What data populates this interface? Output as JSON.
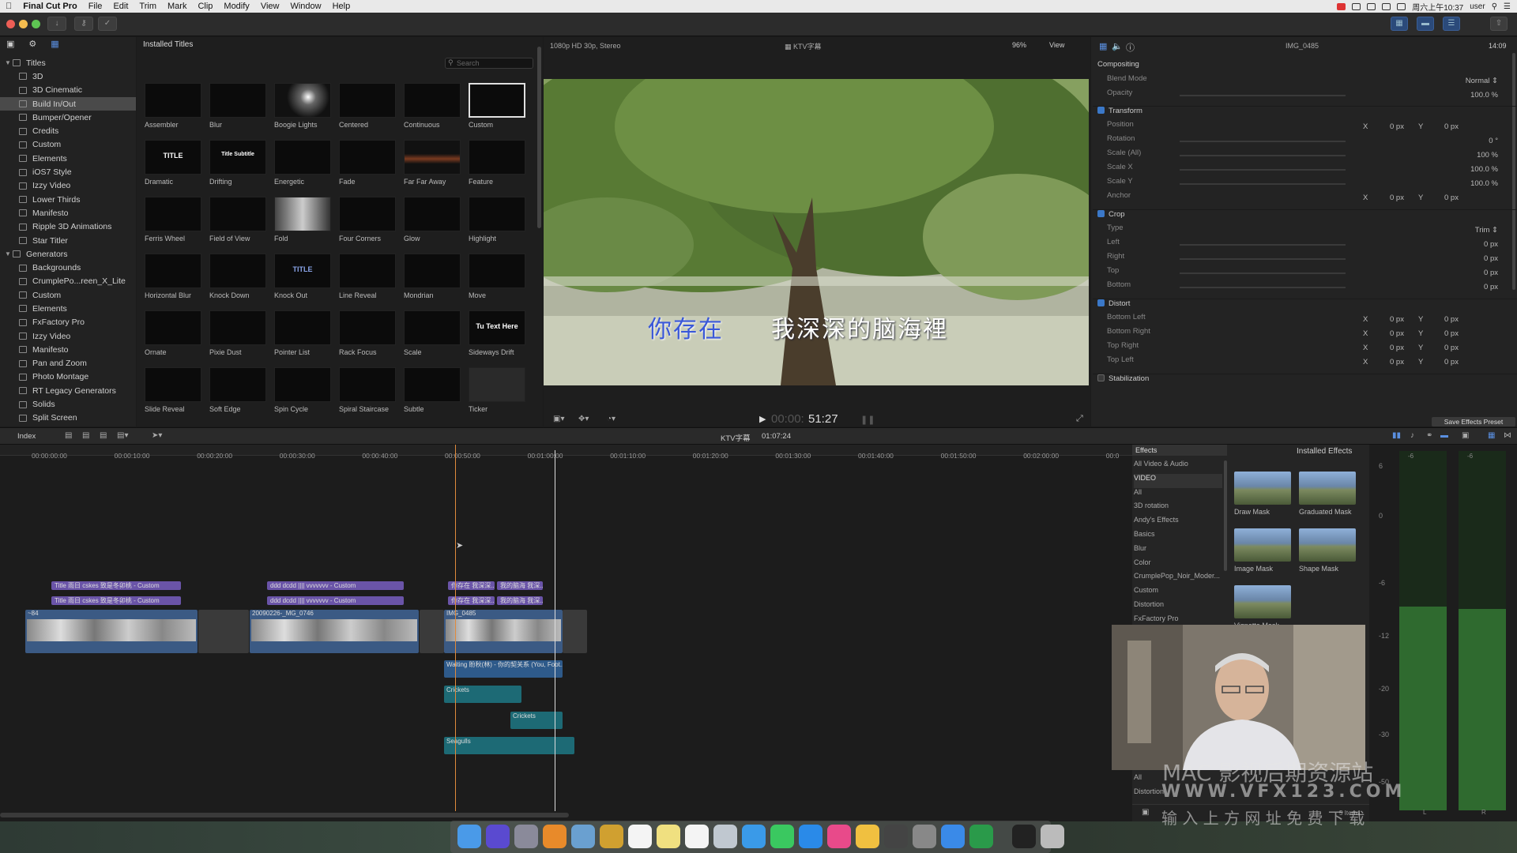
{
  "menubar": {
    "app": "Final Cut Pro",
    "items": [
      "File",
      "Edit",
      "Trim",
      "Mark",
      "Clip",
      "Modify",
      "View",
      "Window",
      "Help"
    ],
    "clock": "周六上午10:37",
    "user": "user"
  },
  "browser": {
    "title": "Installed Titles",
    "search_placeholder": "Search",
    "categories": [
      {
        "label": "Titles",
        "group": true
      },
      {
        "label": "3D"
      },
      {
        "label": "3D Cinematic"
      },
      {
        "label": "Build In/Out",
        "selected": true
      },
      {
        "label": "Bumper/Opener"
      },
      {
        "label": "Credits"
      },
      {
        "label": "Custom"
      },
      {
        "label": "Elements"
      },
      {
        "label": "iOS7 Style"
      },
      {
        "label": "Izzy Video"
      },
      {
        "label": "Lower Thirds"
      },
      {
        "label": "Manifesto"
      },
      {
        "label": "Ripple 3D Animations"
      },
      {
        "label": "Star Titler"
      },
      {
        "label": "Generators",
        "group": true
      },
      {
        "label": "Backgrounds"
      },
      {
        "label": "CrumplePo...reen_X_Lite"
      },
      {
        "label": "Custom"
      },
      {
        "label": "Elements"
      },
      {
        "label": "FxFactory Pro"
      },
      {
        "label": "Izzy Video"
      },
      {
        "label": "Manifesto"
      },
      {
        "label": "Pan and Zoom"
      },
      {
        "label": "Photo Montage"
      },
      {
        "label": "RT Legacy Generators"
      },
      {
        "label": "Solids"
      },
      {
        "label": "Split Screen"
      }
    ],
    "thumbnails": [
      "Assembler",
      "Blur",
      "Boogie Lights",
      "Centered",
      "Continuous",
      "Custom",
      "Dramatic",
      "Drifting",
      "Energetic",
      "Fade",
      "Far Far Away",
      "Feature",
      "Ferris Wheel",
      "Field of View",
      "Fold",
      "Four Corners",
      "Glow",
      "Highlight",
      "Horizontal Blur",
      "Knock Down",
      "Knock Out",
      "Line Reveal",
      "Mondrian",
      "Move",
      "Ornate",
      "Pixie Dust",
      "Pointer List",
      "Rack Focus",
      "Scale",
      "Sideways Drift",
      "Slide Reveal",
      "Soft Edge",
      "Spin Cycle",
      "Spiral Staircase",
      "Subtle",
      "Ticker"
    ],
    "thumb_texts": {
      "dramatic": "TITLE",
      "drifting": "Title Subtitle",
      "knockout": "TITLE",
      "sideways": "Tu Text Here"
    }
  },
  "viewer": {
    "format": "1080p HD 30p, Stereo",
    "project": "KTV字幕",
    "zoom": "96%",
    "view_label": "View",
    "subtitle_blue": "你存在",
    "subtitle_white": "我深深的脑海裡",
    "timecode_dim": "00:00:",
    "timecode": "51:27"
  },
  "inspector": {
    "clip_name": "IMG_0485",
    "duration": "14:09",
    "rows": [
      {
        "label": "Compositing",
        "section": true
      },
      {
        "label": "Blend Mode",
        "value": "Normal ⇕"
      },
      {
        "label": "Opacity",
        "value": "100.0  %"
      },
      {
        "label": "Transform",
        "section": true,
        "check": true
      },
      {
        "label": "Position",
        "x": "0  px",
        "y": "0  px"
      },
      {
        "label": "Rotation",
        "value": "0  °"
      },
      {
        "label": "Scale (All)",
        "value": "100  %"
      },
      {
        "label": "Scale X",
        "value": "100.0  %"
      },
      {
        "label": "Scale Y",
        "value": "100.0  %"
      },
      {
        "label": "Anchor",
        "x": "0  px",
        "y": "0  px"
      },
      {
        "label": "Crop",
        "section": true,
        "check": true
      },
      {
        "label": "Type",
        "value": "Trim ⇕"
      },
      {
        "label": "Left",
        "value": "0  px"
      },
      {
        "label": "Right",
        "value": "0  px"
      },
      {
        "label": "Top",
        "value": "0  px"
      },
      {
        "label": "Bottom",
        "value": "0  px"
      },
      {
        "label": "Distort",
        "section": true,
        "check": true
      },
      {
        "label": "Bottom Left",
        "x": "0  px",
        "y": "0  px"
      },
      {
        "label": "Bottom Right",
        "x": "0  px",
        "y": "0  px"
      },
      {
        "label": "Top Right",
        "x": "0  px",
        "y": "0  px"
      },
      {
        "label": "Top Left",
        "x": "0  px",
        "y": "0  px"
      },
      {
        "label": "Stabilization",
        "section": true,
        "check": false
      }
    ],
    "save_preset": "Save Effects Preset"
  },
  "timeline": {
    "index_label": "Index",
    "project": "KTV字幕",
    "duration": "01:07:24",
    "ruler": [
      "00:00:00:00",
      "00:00:10:00",
      "00:00:20:00",
      "00:00:30:00",
      "00:00:40:00",
      "00:00:50:00",
      "00:01:00:00",
      "00:01:10:00",
      "00:01:20:00",
      "00:01:30:00",
      "00:01:40:00",
      "00:01:50:00",
      "00:02:00:00",
      "00:0"
    ],
    "title_clips": [
      "Title  雨日  cskes  致是冬卯桃 - Custom",
      "Title  雨日  cskes  致是冬卯桃 - Custom",
      "ddd  dcdd  ||||  vvvvvvv - Custom",
      "ddd  dcdd  ||||  vvvvvvv - Custom",
      "你存在  我深深...",
      "我的脑海  我深...",
      "你存在  我深深...",
      "我的脑海  我深..."
    ],
    "video_clips": [
      "~84",
      "20090226-_MG_0746",
      "IMG_0485"
    ],
    "audio_clips": [
      "Waiting 盼秋(林) - 你的契关系 (You, Foot...",
      "Crickets",
      "Crickets",
      "Seagulls"
    ]
  },
  "effects": {
    "header": "Effects",
    "title": "Installed Effects",
    "categories": [
      "All Video & Audio",
      "VIDEO",
      "All",
      "3D rotation",
      "Andy's Effects",
      "Basics",
      "Blur",
      "Color",
      "CrumplePop_Noir_Moder...",
      "Custom",
      "Distortion",
      "FxFactory Pro"
    ],
    "bottom_categories": [
      "All",
      "Distortion"
    ],
    "items": [
      "Draw Mask",
      "Graduated Mask",
      "Image Mask",
      "Shape Mask",
      "Vignette Mask"
    ],
    "items_count": "5 Items"
  },
  "meters": {
    "scale": [
      "6",
      "0",
      "-6",
      "-12",
      "-20",
      "-30",
      "-50"
    ],
    "top": [
      "-6",
      "-6"
    ],
    "channels": [
      "L",
      "R"
    ]
  },
  "watermark": {
    "line1": "MAC 影视后期资源站",
    "line2": "WWW.VFX123.COM",
    "line3": "输 入 上 方 网 址   免 费 下 载"
  },
  "colors": {
    "accent": "#3b78c8",
    "title_clip": "#6a54a8",
    "video_clip": "#3b5a84",
    "audio_clip": "#1d6a75",
    "playhead": "#e08a3c"
  }
}
